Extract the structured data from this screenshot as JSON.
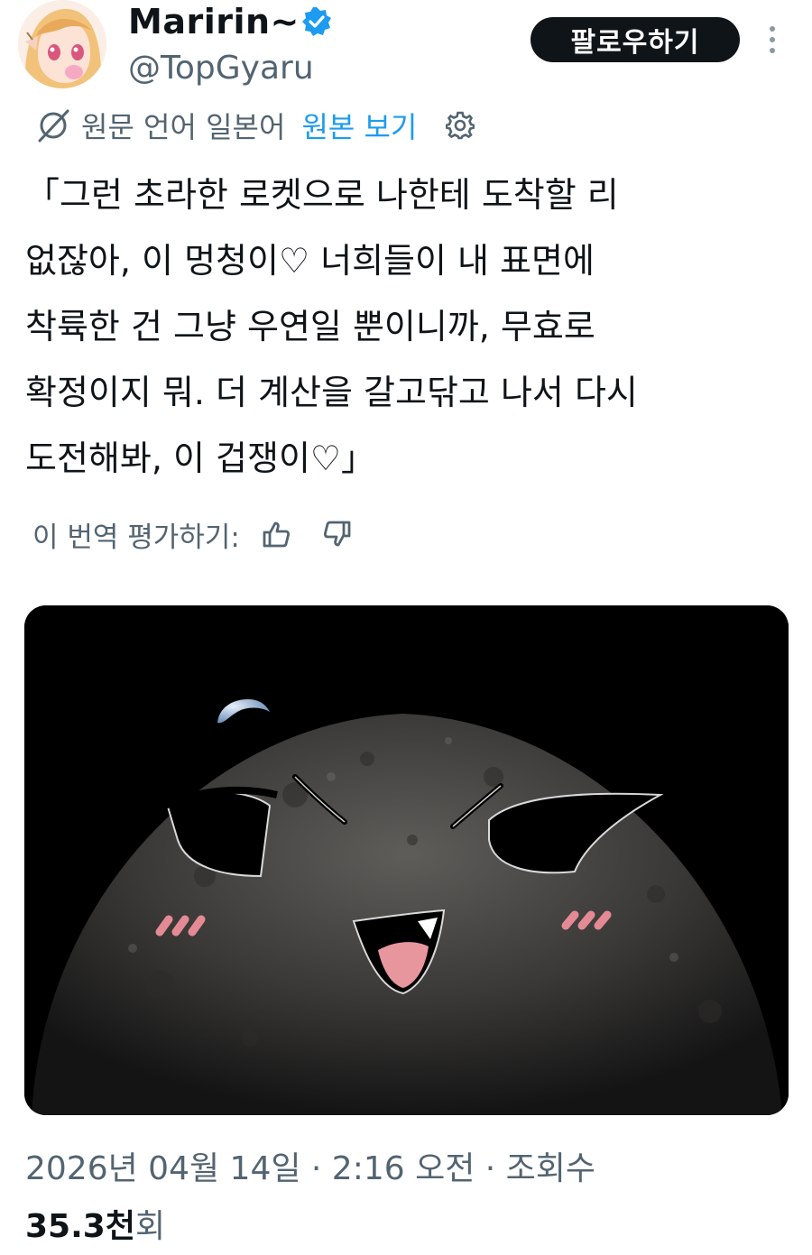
{
  "tweet": {
    "author": {
      "display_name": "Maririn~",
      "handle": "@TopGyaru",
      "verified": true,
      "avatar_icon": "anime-girl-avatar"
    },
    "follow_label": "팔로우하기",
    "more_icon": "vertical-ellipsis-icon",
    "translation": {
      "icon": "translate-icon",
      "source_label": "원문 언어 일본어",
      "show_original_label": "원본 보기",
      "settings_icon": "gear-icon"
    },
    "text": "「그런 초라한 로켓으로 나한테 도착할 리\n없잖아, 이 멍청이♡ 너희들이 내 표면에\n착륙한 건 그냥 우연일 뿐이니까, 무효로\n확정이지 뭐. 더 계산을 갈고닦고 나서 다시\n도전해봐, 이 겁쟁이♡」",
    "rate_translation_label": "이 번역 평가하기:",
    "media": {
      "description_icon": "moon-face-image"
    },
    "timestamp": "2026년 04월 14일 · 2:16 오전 · 조회수",
    "views_count": "35.3천",
    "views_suffix": "회"
  },
  "colors": {
    "text_primary": "#0f1419",
    "text_secondary": "#536471",
    "accent": "#1d9bf0",
    "follow_bg": "#0f1419"
  }
}
